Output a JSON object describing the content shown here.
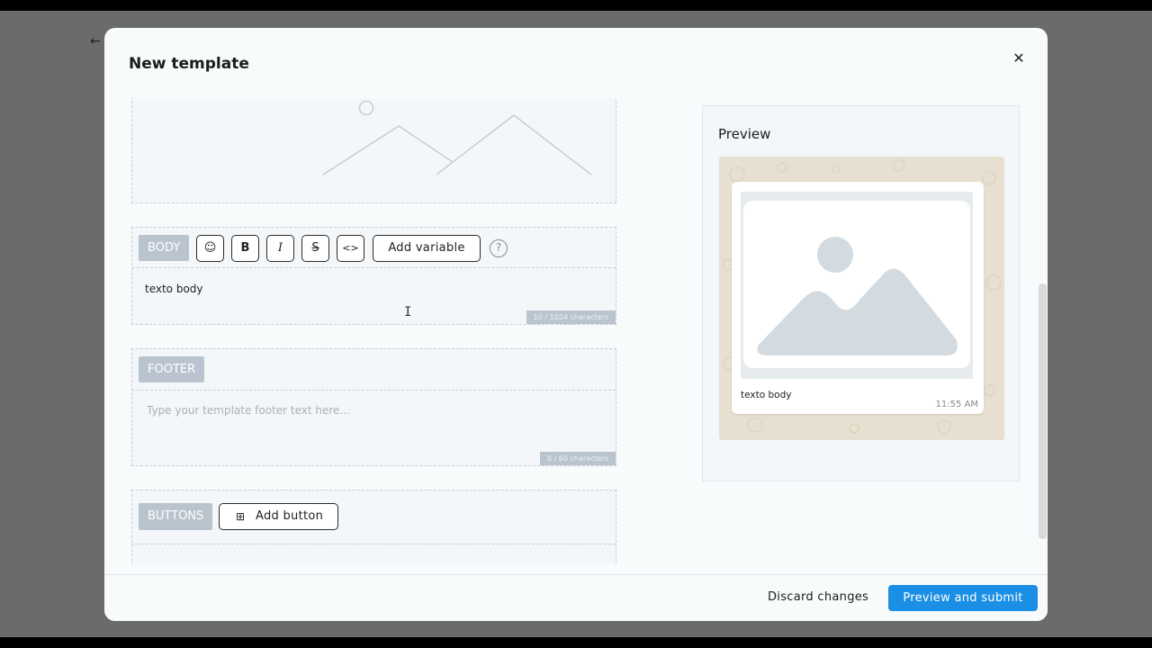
{
  "modal": {
    "title": "New template",
    "close_icon": "close-icon"
  },
  "body_section": {
    "tag": "BODY",
    "tools": [
      {
        "icon": "emoji-icon",
        "glyph": "☺"
      },
      {
        "icon": "bold-icon",
        "glyph": "B"
      },
      {
        "icon": "italic-icon",
        "glyph": "I"
      },
      {
        "icon": "strikethrough-icon",
        "glyph": "S"
      },
      {
        "icon": "code-icon",
        "glyph": "<>"
      }
    ],
    "add_variable_label": "Add variable",
    "help_glyph": "?",
    "text": "texto body",
    "counter": "10 / 1024 characters"
  },
  "footer_section": {
    "tag": "FOOTER",
    "placeholder": "Type your template footer text here...",
    "counter": "0 / 60 characters"
  },
  "buttons_section": {
    "tag": "BUTTONS",
    "add_button_label": "Add button",
    "add_icon": "plus-square-icon"
  },
  "preview": {
    "title": "Preview",
    "message_text": "texto body",
    "time": "11:55 AM"
  },
  "actions": {
    "discard_label": "Discard changes",
    "submit_label": "Preview and submit"
  },
  "colors": {
    "accent": "#1b8fe6",
    "tag_bg": "#b9c4ce",
    "chat_bg": "#e7dfcf"
  }
}
